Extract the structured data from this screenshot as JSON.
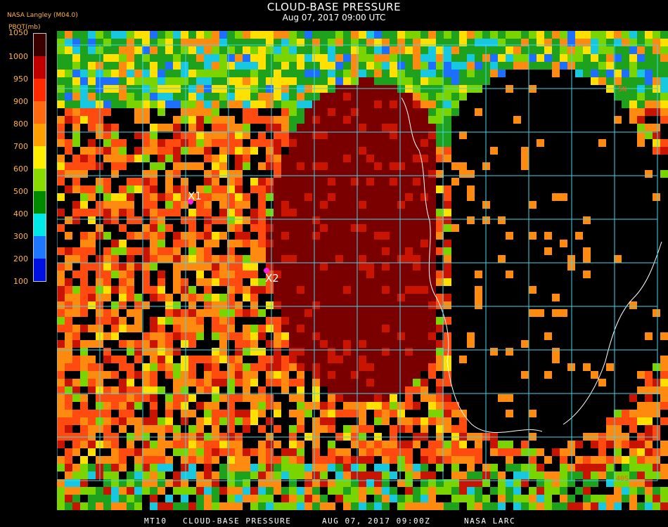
{
  "header": {
    "title": "CLOUD-BASE PRESSURE",
    "subtitle": "Aug 07, 2017 09:00 UTC",
    "org": "NASA Langley (M04.0)",
    "units": "PBOT(mb)"
  },
  "legend": {
    "labels": [
      "1050",
      "1000",
      "950",
      "900",
      "800",
      "700",
      "600",
      "500",
      "400",
      "300",
      "200",
      "100"
    ],
    "colors": [
      "#3a0000",
      "#c00000",
      "#ff2a00",
      "#ff6a10",
      "#ffa000",
      "#ffee00",
      "#8adc00",
      "#008a00",
      "#00e8e8",
      "#1e78ff",
      "#0010e0",
      "#8c3ce0"
    ]
  },
  "map": {
    "colors": {
      "grid": "#3fd6e8",
      "coast": "#ffffff",
      "marker": "#ff1ee8",
      "clear": "#000000",
      "deep_red": "#7a0000",
      "red": "#c81400",
      "orange_red": "#ff4a10",
      "orange": "#ff8a10",
      "yellow": "#ffe000",
      "green": "#1ea21e",
      "light_green": "#7ad400",
      "cyan": "#18c8e0",
      "blue": "#1e6eff"
    },
    "markers": [
      {
        "label": "X1"
      },
      {
        "label": "X2"
      }
    ],
    "grid_labels": [
      "5N",
      "40S"
    ]
  },
  "footer": {
    "product": "MT10",
    "product_title": "CLOUD-BASE PRESSURE",
    "datetime": "AUG 07, 2017 09:00Z",
    "source": "NASA LARC"
  }
}
